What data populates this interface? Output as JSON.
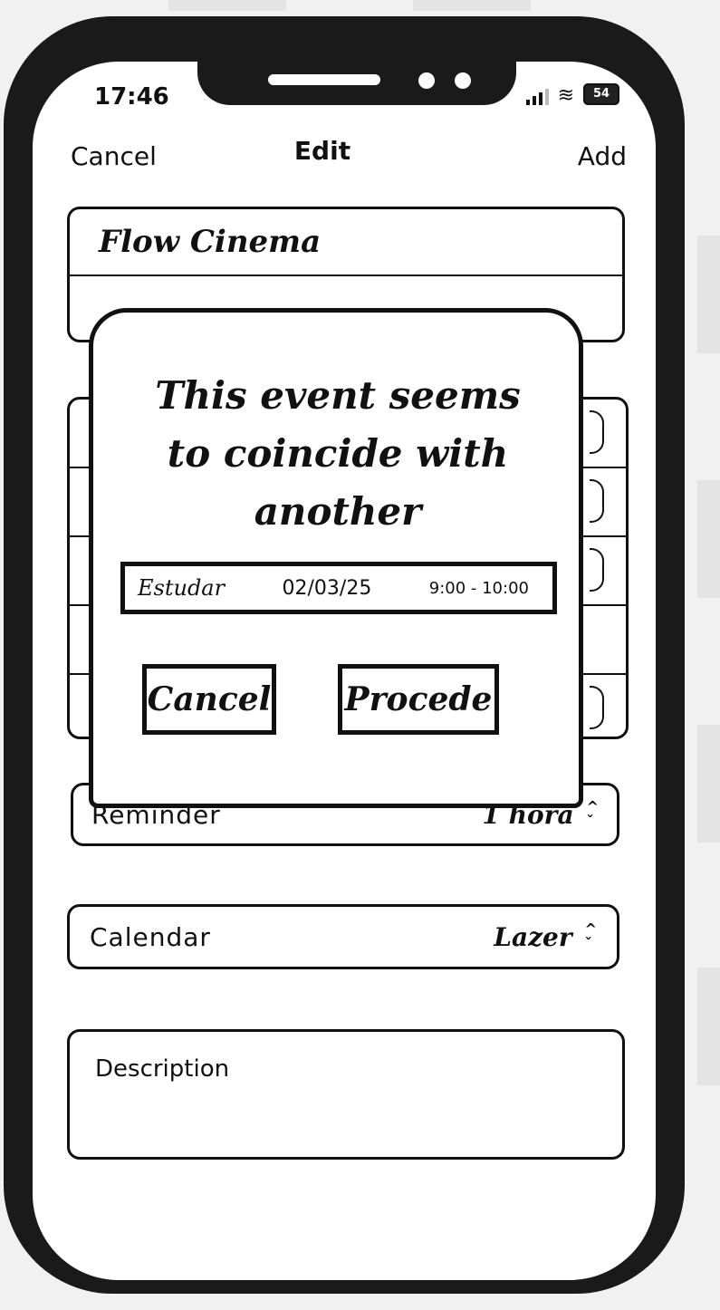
{
  "status_bar": {
    "time": "17:46",
    "battery": "54"
  },
  "nav": {
    "cancel_label": "Cancel",
    "title": "Edit",
    "add_label": "Add"
  },
  "form": {
    "event_title": "Flow Cinema",
    "reminder_label": "Reminder",
    "reminder_value": "1 hora",
    "calendar_label": "Calendar",
    "calendar_value": "Lazer",
    "description_placeholder": "Description"
  },
  "dialog": {
    "message": "This event seems to coincide with another",
    "conflict": {
      "name": "Estudar",
      "date": "02/03/25",
      "time": "9:00 - 10:00"
    },
    "cancel_label": "Cancel",
    "proceed_label": "Procede"
  },
  "icons": {
    "signal": "signal-icon",
    "wifi": "wifi-icon",
    "battery": "battery-icon",
    "stepper": "chevron-up-down-icon"
  }
}
